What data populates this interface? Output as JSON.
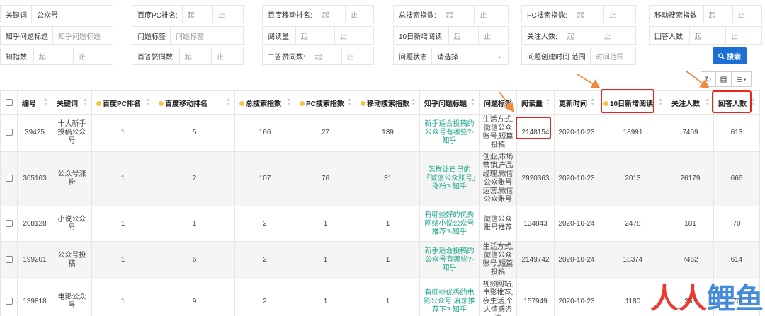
{
  "filters": {
    "keyword": {
      "label": "关键词",
      "value": "公众号"
    },
    "baidu_pc_rank": {
      "label": "百度PC排名:",
      "from": "起",
      "to": "止"
    },
    "baidu_mobile_rank": {
      "label": "百度移动排名:",
      "from": "起",
      "to": "止"
    },
    "total_search": {
      "label": "总搜索指数:",
      "from": "起",
      "to": "止"
    },
    "pc_search": {
      "label": "PC搜索指数:",
      "from": "起",
      "to": "止"
    },
    "mobile_search": {
      "label": "移动搜索指数:",
      "from": "起",
      "to": "止"
    },
    "zhihu_title": {
      "label": "知乎问题标题",
      "placeholder": "知乎问题标题"
    },
    "question_tag": {
      "label": "问题标签",
      "placeholder": "问题标签"
    },
    "reads": {
      "label": "阅读量:",
      "from": "起",
      "to": "止"
    },
    "new_reads_10d": {
      "label": "10日新增阅读:",
      "from": "起",
      "to": "止"
    },
    "followers": {
      "label": "关注人数:",
      "from": "起",
      "to": "止"
    },
    "answerers": {
      "label": "回答人数:",
      "from": "起",
      "to": "止"
    },
    "zhi_index": {
      "label": "知指数:",
      "from": "起",
      "to": "止"
    },
    "first_likes": {
      "label": "首答赞同数:",
      "from": "起",
      "to": "止"
    },
    "second_likes": {
      "label": "二答赞同数:",
      "from": "起",
      "to": "止"
    },
    "question_status": {
      "label": "问题状态",
      "value": "请选择"
    },
    "created_time": {
      "label": "问题创建时间 范围",
      "placeholder": "时间范围"
    },
    "search_button": "搜索"
  },
  "toolbar": {
    "refresh_icon": "refresh-icon",
    "toggle_icon": "columns-toggle-icon",
    "columns_icon": "list-menu-icon"
  },
  "table": {
    "headers": {
      "id": "编号",
      "keyword": "关键词",
      "baidu_pc_rank": "百度PC排名",
      "baidu_mobile_rank": "百度移动排名",
      "total_search": "总搜索指数",
      "pc_search": "PC搜索指数",
      "mobile_search": "移动搜索指数",
      "zhihu_title": "知乎问题标题",
      "question_tag": "问题标签",
      "reads": "阅读量",
      "updated": "更新时间",
      "new_reads_10d": "10日新增阅读",
      "followers": "关注人数",
      "answerers": "回答人数"
    },
    "rows": [
      {
        "id": "39425",
        "keyword": "十大新手投稿公众号",
        "pc": "1",
        "mobile": "5",
        "total": "166",
        "pcs": "27",
        "ms": "139",
        "title": "新手适合投稿的公众号有哪些?-知乎",
        "tag": "生活方式,微信公众账号,短篇投稿",
        "reads": "2148154",
        "updated": "2020-10-23",
        "new10": "18991",
        "followers": "7459",
        "answerers": "613"
      },
      {
        "id": "305163",
        "keyword": "公众号涨粉",
        "pc": "1",
        "mobile": "2",
        "total": "107",
        "pcs": "76",
        "ms": "31",
        "title": "怎样让自己的「微信公众账号」涨粉?-知乎",
        "tag": "创业,市场营销,产品经理,微信公众账号运营,微信公众账号",
        "reads": "2920363",
        "updated": "2020-10-23",
        "new10": "2013",
        "followers": "26179",
        "answerers": "666"
      },
      {
        "id": "208128",
        "keyword": "小说公众号",
        "pc": "1",
        "mobile": "1",
        "total": "2",
        "pcs": "1",
        "ms": "1",
        "title": "有哪些好的优秀网络小说公众号推荐?-知乎",
        "tag": "微信公众账号推荐",
        "reads": "134843",
        "updated": "2020-10-24",
        "new10": "2478",
        "followers": "181",
        "answerers": "70"
      },
      {
        "id": "199201",
        "keyword": "公众号投稿",
        "pc": "1",
        "mobile": "6",
        "total": "2",
        "pcs": "1",
        "ms": "1",
        "title": "新手适合投稿的公众号有哪些?-知乎",
        "tag": "生活方式,微信公众账号,短篇投稿",
        "reads": "2149742",
        "updated": "2020-10-24",
        "new10": "18374",
        "followers": "7462",
        "answerers": "614"
      },
      {
        "id": "139818",
        "keyword": "电影公众号",
        "pc": "1",
        "mobile": "9",
        "total": "2",
        "pcs": "1",
        "ms": "1",
        "title": "有哪些优秀的电影公众号,麻烦推荐下?-知乎",
        "tag": "视频网站,电影推荐,夜生活,个人情感咨询",
        "reads": "157949",
        "updated": "2020-10-23",
        "new10": "1180",
        "followers": "253",
        "answerers": "70"
      }
    ]
  },
  "watermark": {
    "text1": "人人",
    "text2": "鲤鱼"
  },
  "colors": {
    "accent": "#1c6fd3",
    "link": "#1fa78a",
    "annotation": "#e8261e",
    "arrow": "#f08a3c"
  }
}
